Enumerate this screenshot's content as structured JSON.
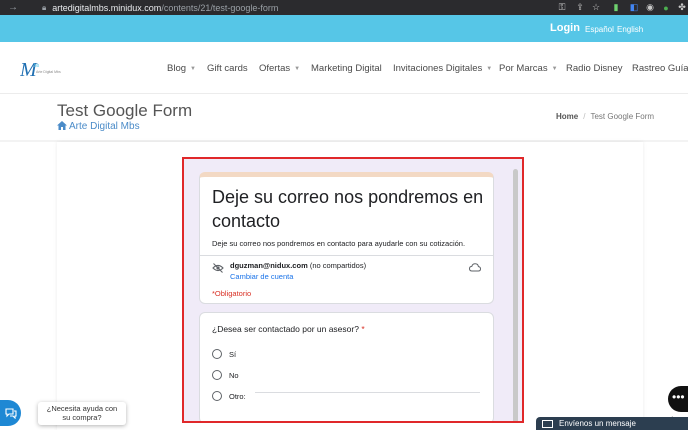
{
  "browser": {
    "url_host": "artedigitalmbs.minidux.com",
    "url_path": "/contents/21/test-google-form",
    "nav_icon": "arrow-right-icon",
    "lock_icon": "lock-icon"
  },
  "topbar": {
    "login": "Login",
    "lang_es": "Español",
    "lang_en": "English",
    "color": "#56c6e7"
  },
  "nav": {
    "items": [
      {
        "label": "Blog",
        "dropdown": true
      },
      {
        "label": "Gift cards",
        "dropdown": false
      },
      {
        "label": "Ofertas",
        "dropdown": true
      },
      {
        "label": "Marketing Digital",
        "dropdown": false
      },
      {
        "label": "Invitaciones Digitales",
        "dropdown": true
      },
      {
        "label": "Por Marcas",
        "dropdown": true
      },
      {
        "label": "Radio Disney",
        "dropdown": false
      },
      {
        "label": "Rastreo Guías",
        "dropdown": false
      }
    ],
    "caret": "▼"
  },
  "page": {
    "title": "Test Google Form",
    "subtitle": "Arte Digital Mbs",
    "breadcrumb_home": "Home",
    "breadcrumb_sep": "/",
    "breadcrumb_current": "Test Google Form"
  },
  "form": {
    "title": "Deje su correo nos pondremos en contacto",
    "description": "Deje su correo nos pondremos en contacto para ayudarle con su cotización.",
    "account_email": "dguzman@nidux.com",
    "account_note": " (no compartidos)",
    "switch_account": "Cambiar de cuenta",
    "required": "*Obligatorio",
    "question": "¿Desea ser contactado por un asesor?",
    "question_required": " *",
    "options": [
      "Sí",
      "No",
      "Otro:"
    ],
    "accent": "#e0282a"
  },
  "chat": {
    "tooltip_line1": "¿Necesita ayuda con",
    "tooltip_line2": "su compra?",
    "more": "•••",
    "tawk": "awchat",
    "message": "Envíenos un mensaje"
  }
}
